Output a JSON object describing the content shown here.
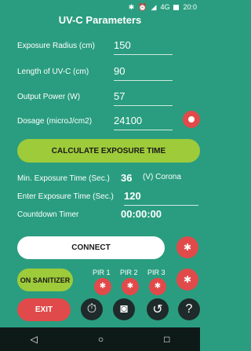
{
  "status": {
    "icons": [
      "bluetooth-icon",
      "alarm-icon",
      "signal-icon"
    ],
    "network": "4G",
    "time": "20:0"
  },
  "title": "UV-C Parameters",
  "fields": [
    {
      "label": "Exposure Radius (cm)",
      "value": "150"
    },
    {
      "label": "Length of UV-C (cm)",
      "value": "90"
    },
    {
      "label": "Output Power (W)",
      "value": "57"
    },
    {
      "label": "Dosage (microJ/cm2)",
      "value": "24100"
    }
  ],
  "calc_button": "CALCULATE EXPOSURE TIME",
  "min_exposure": {
    "label": "Min. Exposure Time (Sec.)",
    "value": "36",
    "note": "(V) Corona"
  },
  "enter_exposure": {
    "label": "Enter Exposure Time (Sec.)",
    "value": "120"
  },
  "countdown": {
    "label": "Countdown Timer",
    "value": "00:00:00"
  },
  "connect_button": "CONNECT",
  "sanitizer_button": "ON SANITIZER",
  "pir_labels": [
    "PIR 1",
    "PIR 2",
    "PIR 3"
  ],
  "exit_button": "EXIT",
  "icons": {
    "bluetooth": "bluetooth-icon",
    "bottom": [
      "timer-icon",
      "camera-icon",
      "history-icon",
      "help-icon"
    ]
  },
  "colors": {
    "background": "#2a9d80",
    "accent_green": "#9ecb3a",
    "red": "#e14a4a",
    "dark": "#1f2a2a"
  }
}
